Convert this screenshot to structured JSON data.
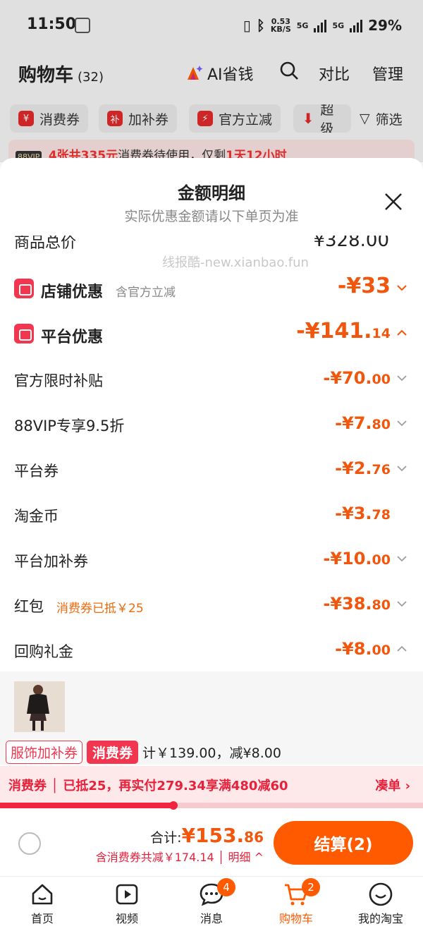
{
  "status_bar": {
    "time": "11:50",
    "speed": "0.53",
    "speed_unit": "KB/S",
    "net1": "5G",
    "net2": "5G",
    "battery": "29%"
  },
  "header": {
    "title": "购物车",
    "count": "(32)",
    "ai_label": "AI省钱",
    "compare": "对比",
    "manage": "管理"
  },
  "chips": [
    "消费券",
    "加补券",
    "官方立减",
    "超级",
    "筛选"
  ],
  "promo_strip": {
    "vip": "88VIP",
    "a": "4张共335元",
    "b": "消费券待使用，仅剩",
    "c": "1天12小时"
  },
  "sheet": {
    "title": "金额明细",
    "subtitle": "实际优惠金额请以下单页为准",
    "peek_label": "商品总价",
    "peek_amount": "¥328.00",
    "watermark": "线报酷-new.xianbao.fun",
    "store": {
      "label": "店铺优惠",
      "note": "含官方立减",
      "amount": "-¥33",
      "dec": ""
    },
    "platform": {
      "label": "平台优惠",
      "amount": "-¥141.",
      "dec": "14"
    },
    "items": [
      {
        "label": "官方限时补贴",
        "amount": "-¥70.",
        "dec": "00"
      },
      {
        "label": "88VIP专享9.5折",
        "amount": "-¥7.",
        "dec": "80"
      },
      {
        "label": "平台券",
        "amount": "-¥2.",
        "dec": "76"
      },
      {
        "label": "淘金币",
        "amount": "-¥3.",
        "dec": "78"
      },
      {
        "label": "平台加补券",
        "amount": "-¥10.",
        "dec": "00"
      },
      {
        "label": "红包",
        "note": "消费券已抵￥25",
        "amount": "-¥38.",
        "dec": "80"
      },
      {
        "label": "回购礼金",
        "amount": "-¥8.",
        "dec": "00"
      }
    ]
  },
  "product": {
    "tag1": "服饰加补券",
    "tag2": "消费券",
    "text": "计￥139.00，减¥8.00"
  },
  "consumption_bar": {
    "text": "消费券 │ 已抵25，再实付279.34享满480减60",
    "link": "凑单 ›",
    "progress": 0.41
  },
  "checkout": {
    "total_label": "合计:",
    "total": "¥153.",
    "total_dec": "86",
    "sub": "含消费券共减￥174.14 │ 明细 ^",
    "button": "结算(2)"
  },
  "tabs": [
    {
      "label": "首页"
    },
    {
      "label": "视频"
    },
    {
      "label": "消息",
      "badge": "4"
    },
    {
      "label": "购物车",
      "badge": "2"
    },
    {
      "label": "我的淘宝"
    }
  ],
  "colors": {
    "accent": "#ff5a00",
    "discount": "#f2560c",
    "red": "#f23650"
  }
}
